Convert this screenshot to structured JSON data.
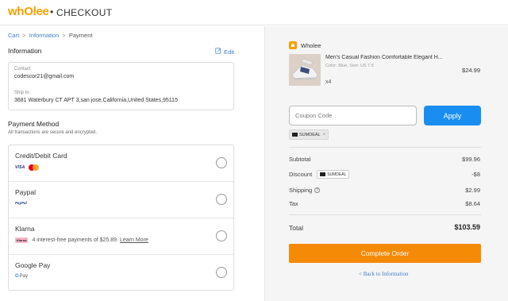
{
  "header": {
    "logo_text": "whOlee",
    "separator": "•",
    "title": "CHECKOUT"
  },
  "breadcrumb": {
    "items": [
      "Cart",
      "Information",
      "Payment"
    ],
    "separator": ">"
  },
  "information": {
    "title": "Information",
    "edit_label": "Edit",
    "contact_label": "Contact",
    "contact_value": "codescor21@gmail.com",
    "ship_label": "Ship to",
    "ship_value": "3681 Waterbury CT APT 3,san jose,California,United States,95115"
  },
  "payment": {
    "title": "Payment Method",
    "subtitle": "All transactions are secure and encrypted.",
    "methods": [
      {
        "name": "Credit/Debit Card",
        "icons": [
          "visa-icon",
          "mastercard-icon"
        ],
        "visa_text": "VISA"
      },
      {
        "name": "Paypal",
        "icons": [
          "paypal-icon"
        ],
        "paypal_text": "PayPal"
      },
      {
        "name": "Klarna",
        "icons": [
          "klarna-icon"
        ],
        "badge_text": "Klarna",
        "description": "4 interest-free payments of $25.89.",
        "link_text": "Learn More"
      },
      {
        "name": "Google Pay",
        "icons": [
          "google-pay-icon"
        ],
        "gpay_g": "G",
        "gpay_text": "Pay"
      }
    ]
  },
  "order": {
    "store_name": "Wholee",
    "product": {
      "name": "Men's Casual Fashion Comfortable Elegant H...",
      "variant": "Color: Blue, Size: US 7.5",
      "price": "$24.99",
      "quantity": "x4"
    },
    "coupon_placeholder": "Coupon Code",
    "apply_label": "Apply",
    "applied_coupon": "SUMDEAL",
    "remove_symbol": "×",
    "subtotal_label": "Subtotal",
    "subtotal_value": "$99.96",
    "discount_label": "Discount",
    "discount_code": "SUMDEAL",
    "discount_value": "-$8",
    "shipping_label": "Shipping",
    "shipping_help": "?",
    "shipping_value": "$2.99",
    "tax_label": "Tax",
    "tax_value": "$8.64",
    "total_label": "Total",
    "total_value": "$103.59",
    "complete_label": "Complete Order",
    "back_label": "< Back to Information"
  },
  "colors": {
    "brand": "#f5a000",
    "link": "#3d7fc8",
    "apply_button": "#1a8ef0",
    "complete_button": "#f58a07",
    "right_panel_bg": "#f5f5f5"
  }
}
